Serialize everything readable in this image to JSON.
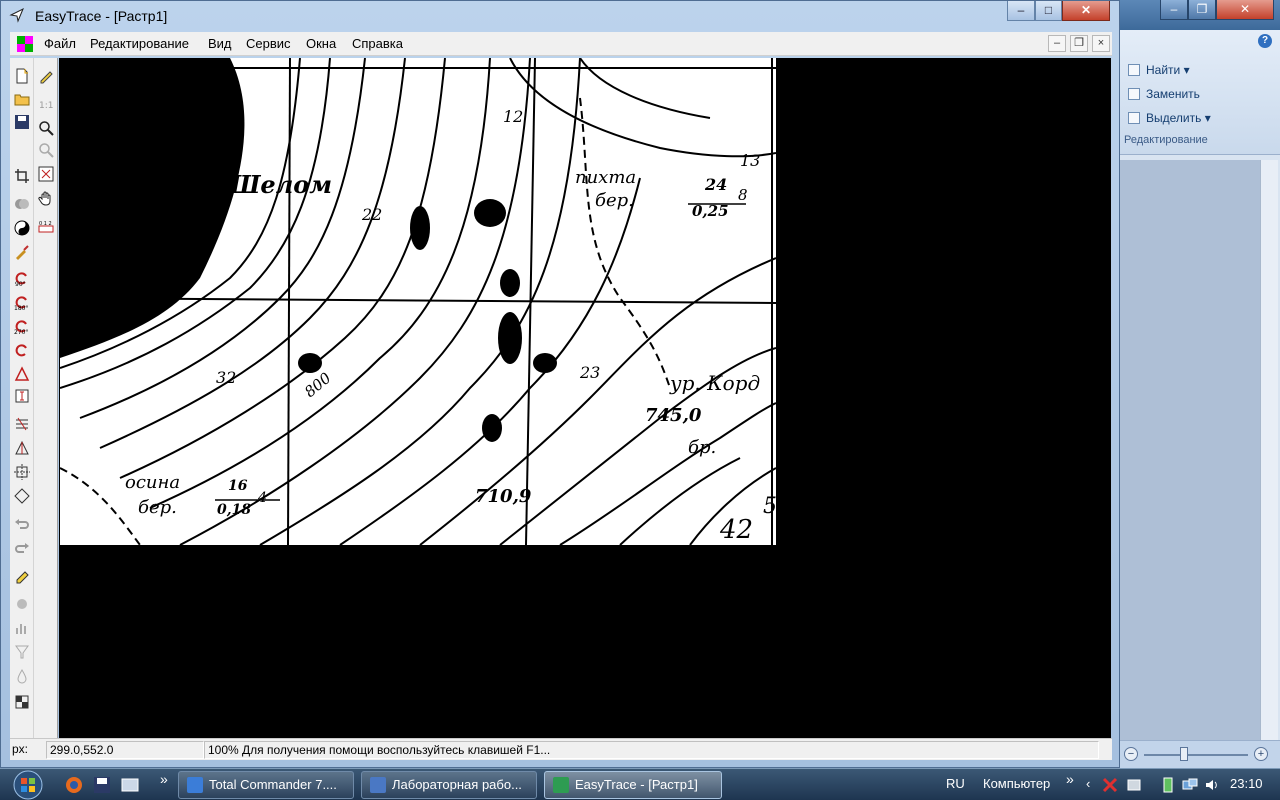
{
  "window": {
    "title": "EasyTrace - [Растр1]",
    "controls": {
      "minimize": "‒",
      "maximize": "□",
      "close": "✕"
    }
  },
  "menubar": {
    "items": [
      "Файл",
      "Редактирование",
      "Вид",
      "Сервис",
      "Окна",
      "Справка"
    ],
    "mdi": {
      "minimize": "–",
      "restore": "❐",
      "close": "×"
    }
  },
  "map": {
    "labels": [
      "Шелом",
      "пихта",
      "бер.",
      "24",
      "0,25",
      "8",
      "13",
      "12",
      "22",
      "32",
      "800",
      "23",
      "ур. Корд",
      "745,0",
      "бр.",
      "осина",
      "бер.",
      "16",
      "0,18",
      "4",
      "710,9",
      "42",
      "5"
    ]
  },
  "statusbar": {
    "coord_label": "px:",
    "coords": "299.0,552.0",
    "message": "100% Для получения помощи воспользуйтесь клавишей F1..."
  },
  "word_bg": {
    "ribbon_items": [
      "Найти",
      "Заменить",
      "Выделить"
    ],
    "group_label": "Редактирование",
    "help": "?"
  },
  "taskbar": {
    "buttons": [
      {
        "label": "Total Commander 7....",
        "color": "#3b7dd8"
      },
      {
        "label": "Лабораторная рабо...",
        "color": "#4a78c4"
      },
      {
        "label": "EasyTrace - [Растр1]",
        "color": "#2e9c52"
      }
    ],
    "lang": "RU",
    "computer": "Компьютер",
    "overflow": "»",
    "time": "23:10"
  },
  "colors": {
    "titlebar": "#bcd3ec",
    "taskbar": "#1e3550",
    "canvas": "#000000",
    "raster": "#ffffff"
  }
}
